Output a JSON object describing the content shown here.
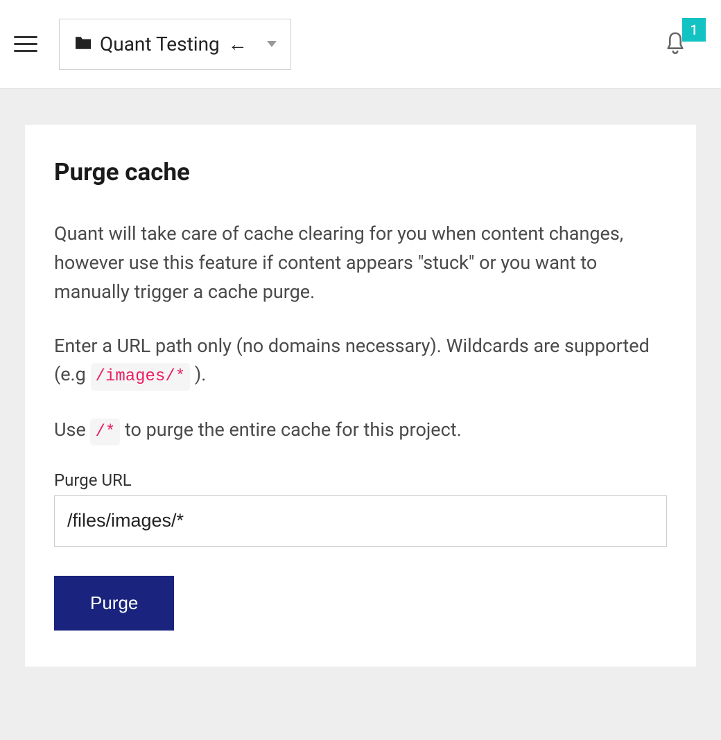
{
  "header": {
    "project_name": "Quant Testing",
    "arrow_glyph": "←",
    "notification_count": "1"
  },
  "main": {
    "title": "Purge cache",
    "desc_para1": "Quant will take care of cache clearing for you when content changes, however use this feature if content appears \"stuck\" or you want to manually trigger a cache purge.",
    "desc_para2_prefix": "Enter a URL path only (no domains necessary). Wildcards are supported (e.g ",
    "desc_para2_code": "/images/*",
    "desc_para2_suffix": " ).",
    "desc_para3_prefix": "Use ",
    "desc_para3_code": "/*",
    "desc_para3_suffix": " to purge the entire cache for this project.",
    "form": {
      "label": "Purge URL",
      "value": "/files/images/*",
      "button": "Purge"
    }
  }
}
